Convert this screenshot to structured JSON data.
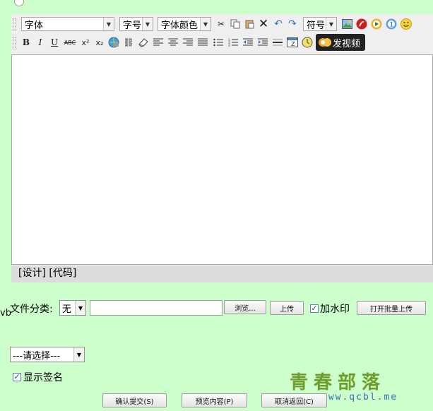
{
  "editor": {
    "font_family": "字体",
    "font_size": "字号",
    "font_color": "字体颜色",
    "symbol": "符号",
    "video_button": "发视频",
    "mode_design": "[设计]",
    "mode_code": "[代码]"
  },
  "form": {
    "vb_label": "vb",
    "file_category_label": "文件分类:",
    "file_category_value": "无",
    "browse_button": "浏览...",
    "upload_button": "上传",
    "watermark_label": "加水印",
    "batch_upload_button": "打开批量上传",
    "select_placeholder": "---请选择---",
    "show_signature_label": "显示签名",
    "submit_button": "确认提交(S)",
    "preview_button": "预览内容(P)",
    "cancel_button": "取消返回(C)"
  },
  "watermark": {
    "logo": "青春部落",
    "url": "www.qcbl.me"
  }
}
